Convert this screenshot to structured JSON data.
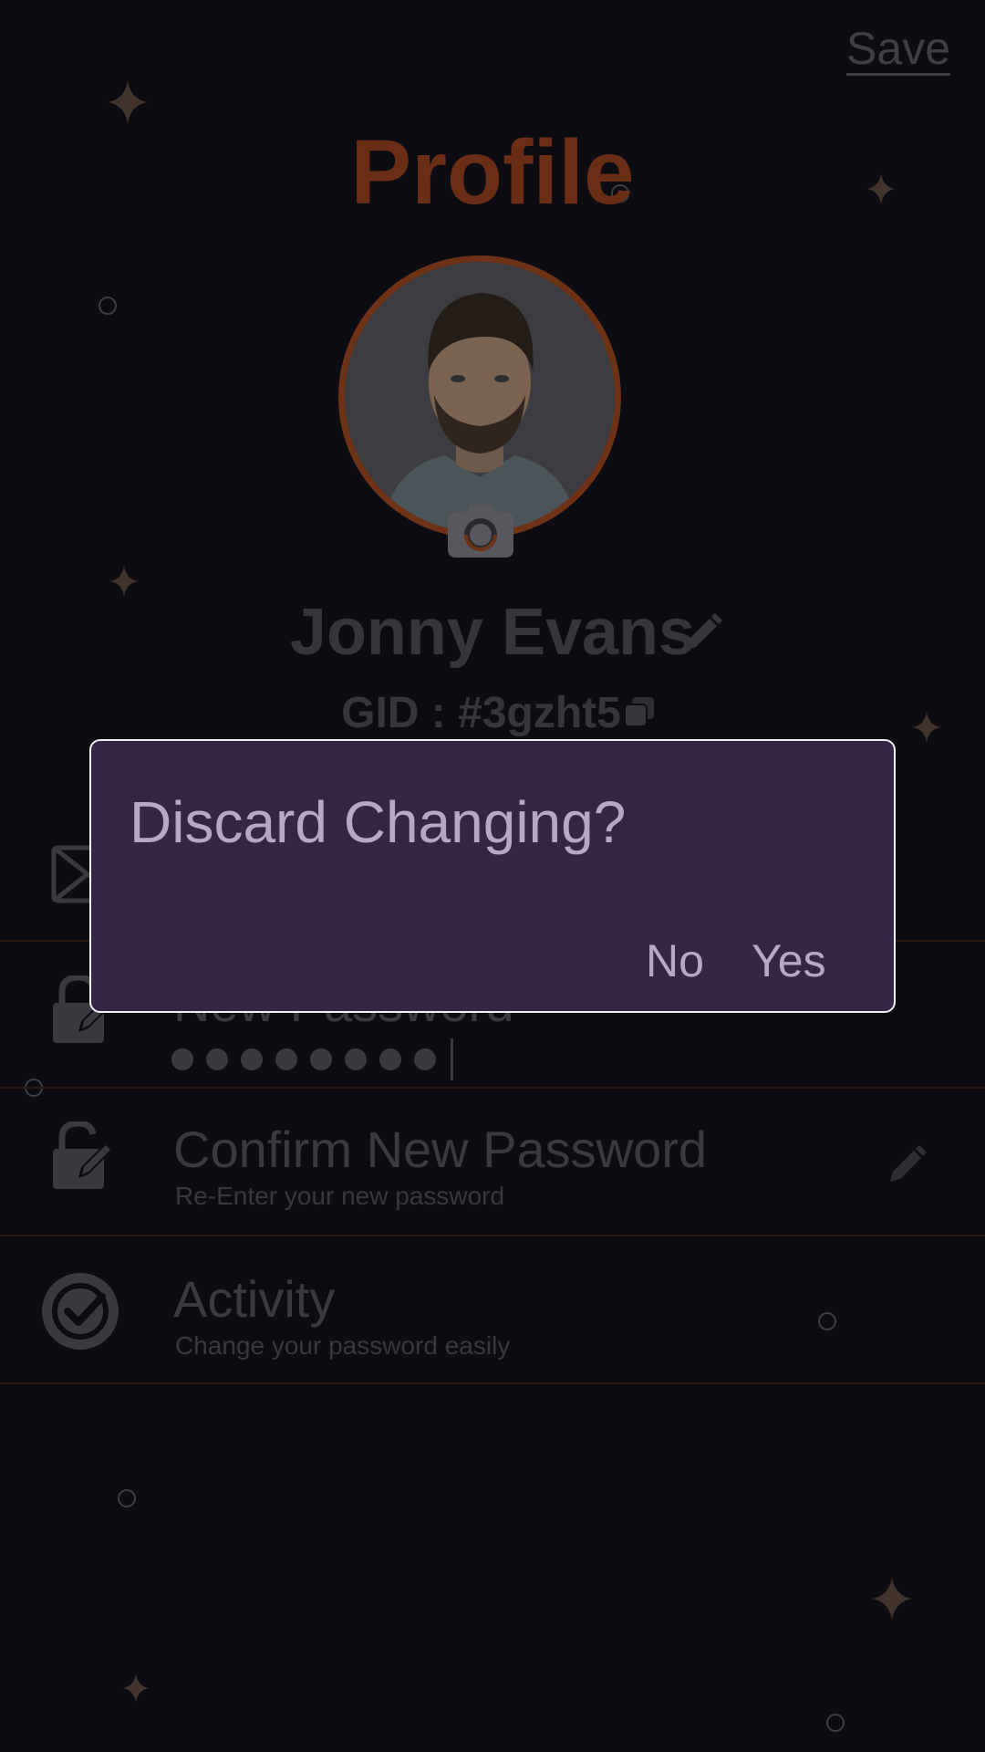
{
  "header": {
    "save_label": "Save",
    "title": "Profile"
  },
  "profile": {
    "name": "Jonny Evans",
    "gid": "GID : #3gzht5"
  },
  "rows": [
    {
      "title": "",
      "subtitle": "",
      "icon": "mail-icon"
    },
    {
      "title": "New Password",
      "icon": "lock-edit-icon",
      "password_mask_length": 8
    },
    {
      "title": "Confirm New Password",
      "subtitle": "Re-Enter your new password",
      "icon": "lock-edit-icon"
    },
    {
      "title": "Activity",
      "subtitle": "Change your password easily",
      "icon": "check-circle-icon"
    }
  ],
  "dialog": {
    "title": "Discard Changing?",
    "no_label": "No",
    "yes_label": "Yes"
  },
  "colors": {
    "background": "#0d0c13",
    "accent": "#6e3216",
    "dialog_bg": "#342745",
    "dialog_text": "#b6a9c8"
  }
}
